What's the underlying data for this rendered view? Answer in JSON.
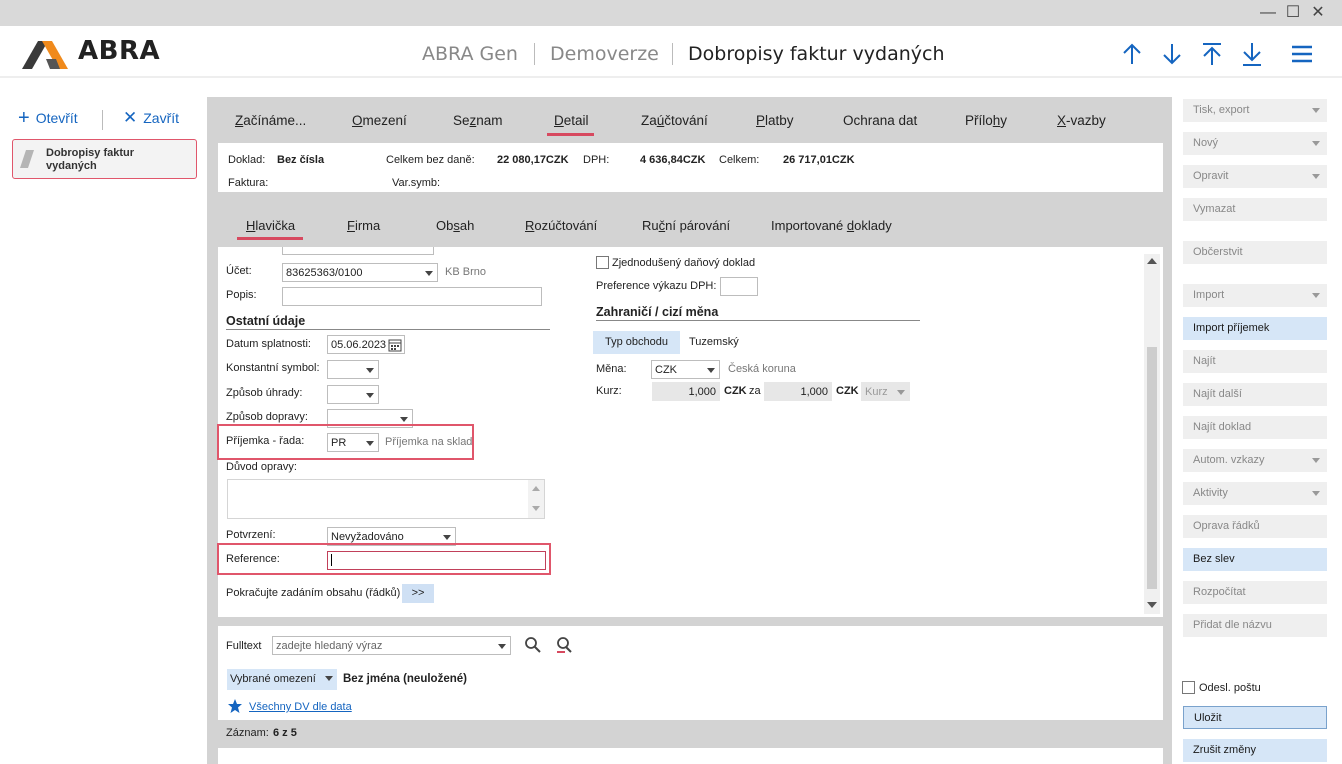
{
  "window": {
    "minimize": "—",
    "maximize": "☐",
    "close": "✕"
  },
  "header": {
    "logo": "ABRA",
    "app": "ABRA Gen",
    "edition": "Demoverze",
    "title": "Dobropisy faktur vydaných"
  },
  "left": {
    "open_label": "Otevřít",
    "close_label": "Zavřít",
    "doc_item": "Dobropisy faktur vydaných"
  },
  "main_tabs": [
    {
      "label": "Začínáme...",
      "key": "Z",
      "rest": "ačínáme..."
    },
    {
      "label": "Omezení",
      "key": "O",
      "rest": "mezení"
    },
    {
      "label": "Seznam",
      "key": "Se",
      "pre": "",
      "rest": "znam"
    },
    {
      "label": "Detail",
      "key": "D",
      "rest": "etail"
    },
    {
      "label": "Zaúčtování",
      "key": "Zaú",
      "rest": "čtování"
    },
    {
      "label": "Platby",
      "key": "P",
      "rest": "latby"
    },
    {
      "label": "Ochrana dat"
    },
    {
      "label": "Přílohy"
    },
    {
      "label": "X-vazby"
    }
  ],
  "info": {
    "doklad_label": "Doklad:",
    "doklad_value": "Bez čísla",
    "celkem_bez_dane_label": "Celkem bez daně:",
    "celkem_bez_dane_value": "22 080,17CZK",
    "dph_label": "DPH:",
    "dph_value": "4 636,84CZK",
    "celkem_label": "Celkem:",
    "celkem_value": "26 717,01CZK",
    "faktura_label": "Faktura:",
    "varsymb_label": "Var.symb:"
  },
  "sub_tabs": [
    "Hlavička",
    "Firma",
    "Obsah",
    "Rozúčtování",
    "Ruční párování",
    "Importované doklady"
  ],
  "form": {
    "ucet_label": "Účet:",
    "ucet_value": "83625363/0100",
    "ucet_bank": "KB Brno",
    "popis_label": "Popis:",
    "ostatni_heading": "Ostatní údaje",
    "datum_splatnosti_label": "Datum splatnosti:",
    "datum_splatnosti_value": "05.06.2023",
    "konstantni_label": "Konstantní symbol:",
    "zpusob_uhrady_label": "Způsob úhrady:",
    "zpusob_dopravy_label": "Způsob dopravy:",
    "prijemka_label": "Příjemka - řada:",
    "prijemka_value": "PR",
    "prijemka_desc": "Příjemka na sklad",
    "duvod_label": "Důvod opravy:",
    "potvrzeni_label": "Potvrzení:",
    "potvrzeni_value": "Nevyžadováno",
    "reference_label": "Reference:",
    "continue_label": "Pokračujte zadáním obsahu (řádků)",
    "continue_button": ">>",
    "zjednoduseny_label": "Zjednodušený daňový doklad",
    "preference_label": "Preference výkazu DPH:",
    "zahranici_heading": "Zahraničí / cizí měna",
    "typ_obchodu_label": "Typ obchodu",
    "typ_obchodu_value": "Tuzemský",
    "mena_label": "Měna:",
    "mena_value": "CZK",
    "mena_name": "Česká koruna",
    "kurz_label": "Kurz:",
    "kurz_value1": "1,000",
    "kurz_unit1": "CZK",
    "kurz_za": "za",
    "kurz_value2": "1,000",
    "kurz_unit2": "CZK",
    "kurz_select": "Kurz"
  },
  "bottom": {
    "fulltext_label": "Fulltext",
    "fulltext_placeholder": "zadejte hledaný výraz",
    "omezeni_select": "Vybrané omezení",
    "omezeni_name": "Bez jména (neuložené)",
    "favorite_link": "Všechny DV dle data",
    "zaznam_label": "Záznam:",
    "zaznam_value": "6 z 5"
  },
  "actions": [
    {
      "label": "Tisk, export",
      "dropdown": true,
      "style": "gray"
    },
    {
      "label": "Nový",
      "dropdown": true,
      "style": "gray"
    },
    {
      "label": "Opravit",
      "dropdown": true,
      "style": "gray"
    },
    {
      "label": "Vymazat",
      "dropdown": false,
      "style": "gray"
    },
    {
      "label": "Občerstvit",
      "dropdown": false,
      "style": "gray"
    },
    {
      "label": "Import",
      "dropdown": true,
      "style": "gray"
    },
    {
      "label": "Import příjemek",
      "dropdown": false,
      "style": "blue"
    },
    {
      "label": "Najít",
      "dropdown": false,
      "style": "gray"
    },
    {
      "label": "Najít další",
      "dropdown": false,
      "style": "gray"
    },
    {
      "label": "Najít doklad",
      "dropdown": false,
      "style": "gray"
    },
    {
      "label": "Autom. vzkazy",
      "dropdown": true,
      "style": "gray"
    },
    {
      "label": "Aktivity",
      "dropdown": true,
      "style": "gray"
    },
    {
      "label": "Oprava řádků",
      "dropdown": false,
      "style": "gray"
    },
    {
      "label": "Bez slev",
      "dropdown": false,
      "style": "blue"
    },
    {
      "label": "Rozpočítat",
      "dropdown": false,
      "style": "gray"
    },
    {
      "label": "Přidat dle názvu",
      "dropdown": false,
      "style": "gray"
    }
  ],
  "odesl_postu_label": "Odesl. poštu",
  "ulozit_label": "Uložit",
  "zrusit_label": "Zrušit změny",
  "colors": {
    "accent": "#1565c0",
    "highlight": "#e0566b",
    "logo_orange": "#f08a1c"
  }
}
